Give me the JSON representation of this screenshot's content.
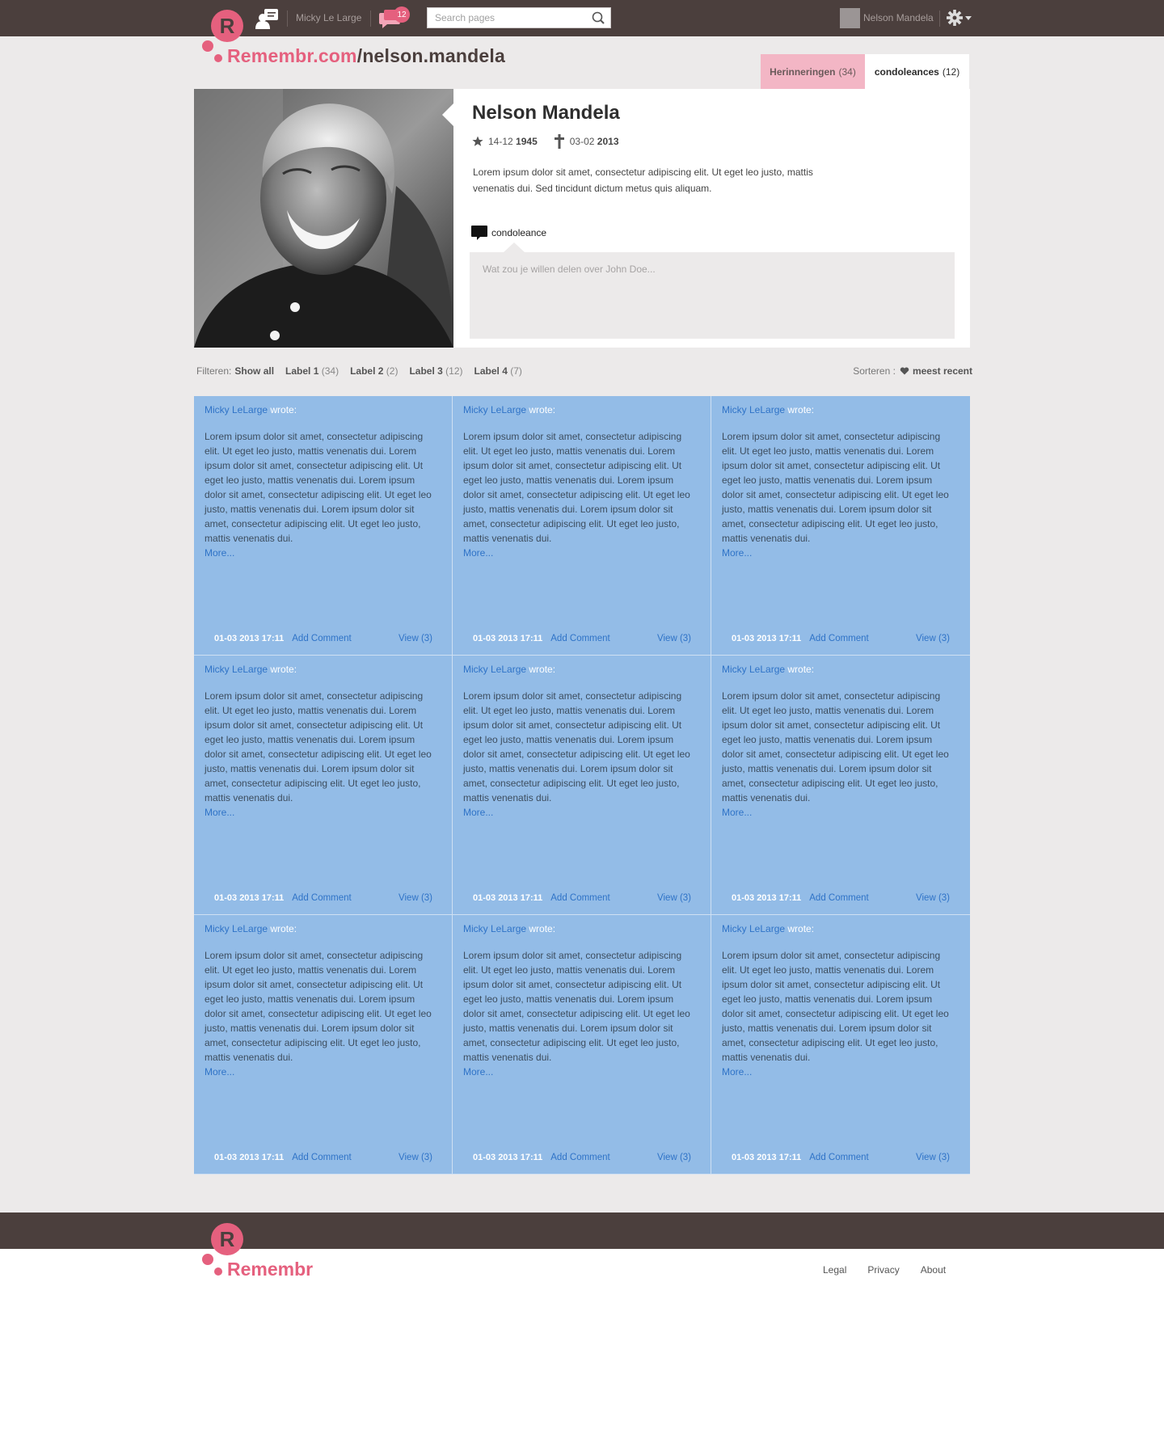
{
  "topbar": {
    "username": "Micky Le Large",
    "notifications_count": "12",
    "search_placeholder": "Search pages",
    "account_name": "Nelson Mandela",
    "logo_letter": "R"
  },
  "brand": {
    "site": "Remembr.com",
    "slash": "/",
    "page": "nelson.mandela"
  },
  "tabs": [
    {
      "label": "Herinneringen",
      "count": "(34)"
    },
    {
      "label": "condoleances",
      "count": "(12)"
    }
  ],
  "profile": {
    "name": "Nelson Mandela",
    "born_daymonth": "14-12",
    "born_year": "1945",
    "died_daymonth": "03-02",
    "died_year": "2013",
    "bio": "Lorem ipsum dolor sit amet, consectetur adipiscing elit. Ut eget leo justo, mattis venenatis dui. Sed tincidunt dictum metus quis aliquam.",
    "condolence_label": "condoleance",
    "condolence_placeholder": "Wat zou je willen delen over John Doe..."
  },
  "filters": {
    "label": "Filteren:",
    "items": [
      {
        "name": "Show all",
        "count": ""
      },
      {
        "name": "Label 1",
        "count": "(34)"
      },
      {
        "name": "Label 2",
        "count": "(2)"
      },
      {
        "name": "Label 3",
        "count": "(12)"
      },
      {
        "name": "Label 4",
        "count": "(7)"
      }
    ],
    "sort_label": "Sorteren :",
    "sort_value": "meest recent"
  },
  "cards": {
    "author": "Micky LeLarge",
    "wrote": "wrote:",
    "body": "Lorem ipsum dolor sit amet, consectetur adipiscing elit. Ut eget leo justo, mattis venenatis dui.  Lorem ipsum dolor sit amet, consectetur adipiscing elit. Ut eget leo justo, mattis venenatis dui. Lorem ipsum dolor sit amet, consectetur adipiscing elit. Ut eget leo justo, mattis venenatis dui. Lorem ipsum dolor sit amet, consectetur adipiscing elit. Ut eget leo justo, mattis venenatis dui.",
    "more": "More...",
    "date": "01-03 2013 17:11",
    "add_comment": "Add Comment",
    "view": "View (3)"
  },
  "footer": {
    "brand": "Remembr",
    "logo_letter": "R",
    "links": [
      "Legal",
      "Privacy",
      "About"
    ]
  },
  "colors": {
    "topbar": "#4b3f3d",
    "brand_pink": "#e5607e",
    "card_blue": "#93bce7",
    "link_blue": "#2f73c7"
  }
}
